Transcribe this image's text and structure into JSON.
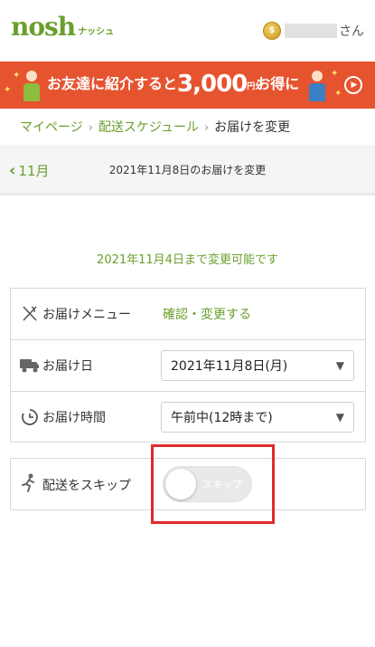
{
  "header": {
    "logo_main": "nosh",
    "logo_sub": "ナッシュ",
    "user_suffix": "さん"
  },
  "banner": {
    "text_pre": "お友達に紹介すると",
    "amount": "3,000",
    "yen": "円分",
    "text_post": "お得に"
  },
  "breadcrumb": {
    "items": [
      "マイページ",
      "配送スケジュール"
    ],
    "current": "お届けを変更"
  },
  "subnav": {
    "back_label": "11月",
    "title": "2021年11月8日のお届けを変更"
  },
  "deadline_text": "2021年11月4日まで変更可能です",
  "delivery": {
    "menu_label": "お届けメニュー",
    "menu_link": "確認・変更する",
    "date_label": "お届け日",
    "date_value": "2021年11月8日(月)",
    "time_label": "お届け時間",
    "time_value": "午前中(12時まで)"
  },
  "skip": {
    "label": "配送をスキップ",
    "toggle_text": "スキップ",
    "enabled": false
  },
  "colors": {
    "brand_green": "#6a9f2d",
    "banner_red": "#e6532f",
    "highlight_red": "#e02b2b"
  }
}
